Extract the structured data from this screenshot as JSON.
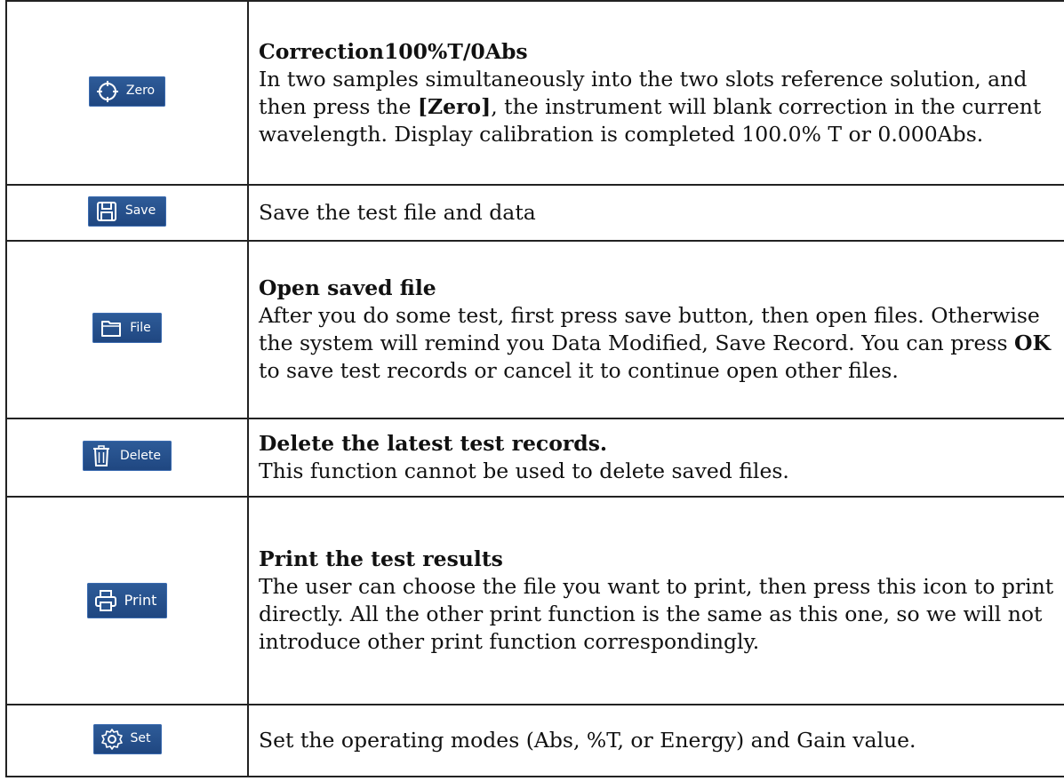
{
  "rows": [
    {
      "button": {
        "label": "Zero",
        "icon": "crosshair-circle-icon"
      },
      "heading": "Correction100%T/0Abs",
      "text_before": "In two samples simultaneously into the two slots reference solution, and then press the ",
      "bold_inline": "[Zero]",
      "text_after": ", the instrument will blank correction in the current wavelength. Display calibration is completed 100.0% T or 0.000Abs."
    },
    {
      "button": {
        "label": "Save",
        "icon": "floppy-disk-icon"
      },
      "text": "Save the test file and data"
    },
    {
      "button": {
        "label": "File",
        "icon": "folder-icon"
      },
      "heading": "Open saved file",
      "text_before": "After you do some test, first press save button, then open files. Otherwise the system will remind you Data Modified, Save Record. You can press ",
      "bold_inline": "OK",
      "text_after": " to save test records or cancel it to continue open other files."
    },
    {
      "button": {
        "label": "Delete",
        "icon": "trash-can-icon"
      },
      "heading": "Delete the latest test records.",
      "text": "This function cannot be used to delete saved files."
    },
    {
      "button": {
        "label": "Print",
        "icon": "printer-icon"
      },
      "heading": "Print the test results",
      "text": "The user can choose the file you want to print, then press this icon to print directly. All the other print function is the same as this one, so we will not introduce other print function correspondingly."
    },
    {
      "button": {
        "label": "Set",
        "icon": "gear-icon"
      },
      "text": "Set the operating modes (Abs, %T, or Energy) and Gain value."
    }
  ],
  "colors": {
    "button_bg": "#2a5590",
    "border": "#222222",
    "text": "#111111"
  }
}
